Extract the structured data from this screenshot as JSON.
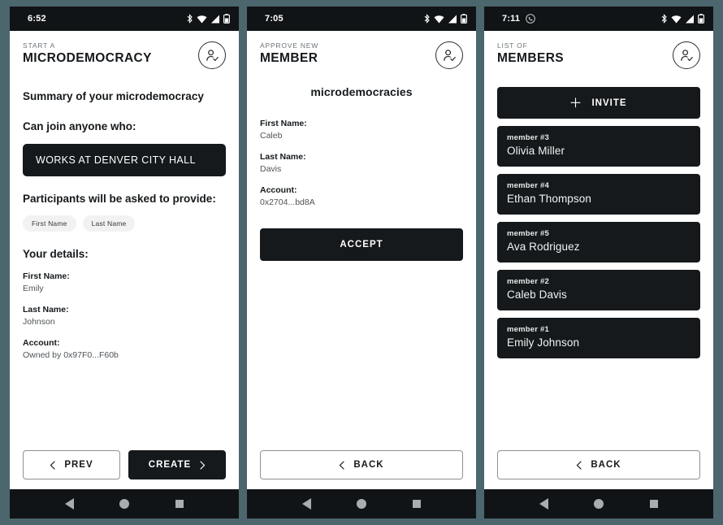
{
  "theme": {
    "page_background": "#4c666e",
    "ink": "#15191c",
    "muted": "#6d7378",
    "card": "#15191c",
    "chip": "#f2f2f2"
  },
  "phones": [
    {
      "status": {
        "time": "6:52",
        "icons": [
          "bluetooth-icon",
          "wifi-icon",
          "signal-icon",
          "battery-icon"
        ]
      },
      "header": {
        "kicker": "START A",
        "title": "MICRODEMOCRACY",
        "avatar_icon": "user-check-icon"
      },
      "summary_heading": "Summary of your microdemocracy",
      "join_heading": "Can join anyone who:",
      "join_rule": "WORKS AT DENVER CITY HALL",
      "provide_heading": "Participants will be asked to provide:",
      "chips": [
        "First Name",
        "Last Name"
      ],
      "details_heading": "Your details:",
      "details": [
        {
          "key": "First Name:",
          "value": "Emily"
        },
        {
          "key": "Last Name:",
          "value": "Johnson"
        },
        {
          "key": "Account:",
          "value": "Owned by 0x97F0...F60b"
        }
      ],
      "footer": {
        "prev_label": "PREV",
        "create_label": "CREATE"
      }
    },
    {
      "status": {
        "time": "7:05",
        "icons": [
          "bluetooth-icon",
          "wifi-icon",
          "signal-icon",
          "battery-icon"
        ]
      },
      "header": {
        "kicker": "APPROVE NEW",
        "title": "MEMBER",
        "avatar_icon": "user-check-icon"
      },
      "center_title": "microdemocracies",
      "details": [
        {
          "key": "First Name:",
          "value": "Caleb"
        },
        {
          "key": "Last Name:",
          "value": "Davis"
        },
        {
          "key": "Account:",
          "value": "0x2704...bd8A"
        }
      ],
      "accept_label": "ACCEPT",
      "footer": {
        "back_label": "BACK"
      }
    },
    {
      "status": {
        "time": "7:11",
        "icons": [
          "whatsapp-icon",
          "bluetooth-icon",
          "wifi-icon",
          "signal-icon",
          "battery-icon"
        ]
      },
      "header": {
        "kicker": "LIST OF",
        "title": "MEMBERS",
        "avatar_icon": "user-check-icon"
      },
      "invite_label": "INVITE",
      "members": [
        {
          "rank": "member #3",
          "name": "Olivia Miller"
        },
        {
          "rank": "member #4",
          "name": "Ethan Thompson"
        },
        {
          "rank": "member #5",
          "name": "Ava Rodriguez"
        },
        {
          "rank": "member #2",
          "name": "Caleb Davis"
        },
        {
          "rank": "member #1",
          "name": "Emily Johnson"
        }
      ],
      "footer": {
        "back_label": "BACK"
      }
    }
  ]
}
